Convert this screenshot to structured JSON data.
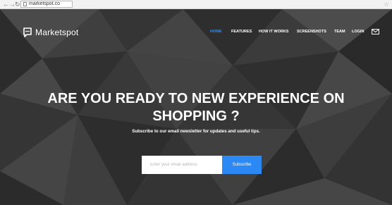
{
  "browser": {
    "back_icon": "arrow-left-icon",
    "forward_icon": "arrow-right-icon",
    "reload_icon": "reload-icon",
    "url": "marketspot.co",
    "bookmark_icon": "star-icon"
  },
  "site": {
    "logo_text": "Marketspot",
    "logo_icon": "chat-bubble-icon"
  },
  "nav": {
    "items": [
      {
        "label": "HOME",
        "active": true
      },
      {
        "label": "FEATURES"
      },
      {
        "label": "HOW IT WORKS"
      },
      {
        "label": "SCREENSHOTS"
      },
      {
        "label": "TEAM"
      },
      {
        "label": "LOGIN"
      }
    ],
    "mail_icon": "envelope-icon"
  },
  "hero": {
    "headline_line1": "ARE YOU READY TO NEW EXPERIENCE ON",
    "headline_line2": "SHOPPING ?",
    "subtitle": "Subscribe to our email newsletter for updates and useful tips.",
    "email_placeholder": "Enter your email address",
    "subscribe_label": "Subscribe"
  },
  "colors": {
    "accent": "#2c88f2",
    "nav_active": "#2e8cff",
    "hero_bg": "#3a3a3a"
  }
}
